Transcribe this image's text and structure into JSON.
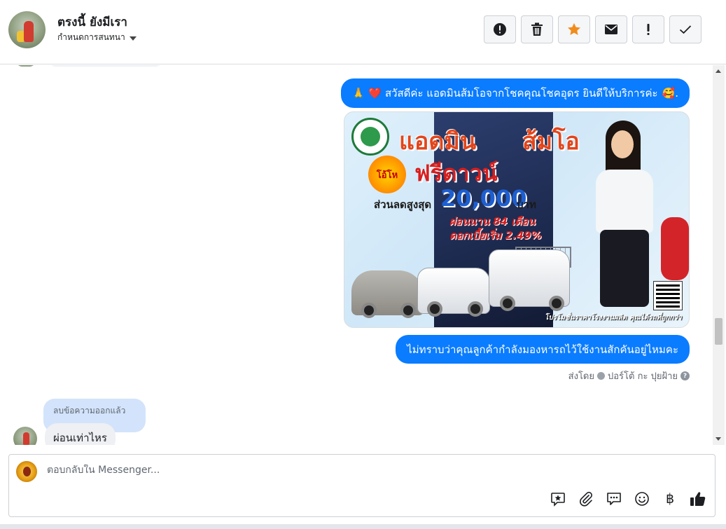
{
  "header": {
    "contact_name": "ตรงนี้ ยังมีเรา",
    "assign_label": "กำหนดการสนทนา",
    "toolbar": [
      {
        "name": "report-spam-button",
        "icon": "alert-circle-icon"
      },
      {
        "name": "delete-button",
        "icon": "trash-icon"
      },
      {
        "name": "star-button",
        "icon": "star-icon"
      },
      {
        "name": "mark-unread-button",
        "icon": "envelope-icon"
      },
      {
        "name": "follow-up-button",
        "icon": "exclamation-icon"
      },
      {
        "name": "mark-done-button",
        "icon": "check-icon"
      }
    ]
  },
  "messages": {
    "greeting_emoji": "🙏",
    "greeting_heart": "❤️",
    "greeting_text": "สวัสดีค่ะ แอดมินส้มโอจากโชคคุณโชคอุดร ยินดีให้บริการค่ะ",
    "greeting_trailing": "🥰.",
    "promo": {
      "title_left": "แอดมิน",
      "title_right": "ส้มโอ",
      "burst": "โอ้โห",
      "headline": "ฟรีดาวน์",
      "discount_label": "ส่วนลดสูงสุด",
      "discount_amount": "20,000",
      "discount_unit": "บาท",
      "installment": "ผ่อนนาน 84 เดือน",
      "interest": "ดอกเบี้ยเริ่ม 2.49%",
      "footer": "โปรโมชั่นราคาโรงงานผลิต คุณได้รถที่ถูกกว่า"
    },
    "question_text": "ไม่ทราบว่าคุณลูกค้ากำลังมองหารถไว้ใช้งานสักคันอยู่ไหมคะ",
    "sent_by_prefix": "ส่งโดย",
    "sent_by_name": "ปอร์โต้ กะ ปุยฝ้าย",
    "removed_label": "ลบข้อความออกแล้ว",
    "incoming_text": "ผ่อนเท่าไหร"
  },
  "composer": {
    "placeholder": "ตอบกลับใน Messenger...",
    "tools": [
      "saved-reply-icon",
      "attachment-icon",
      "chat-bubbles-icon",
      "emoji-icon",
      "baht-icon",
      "thumbs-up-icon"
    ],
    "baht_glyph": "฿"
  },
  "colors": {
    "outgoing_bubble": "#0a7cff",
    "incoming_bubble": "#eef0f3",
    "removed_bubble": "#d3e3fb",
    "star": "#f08c1b"
  }
}
